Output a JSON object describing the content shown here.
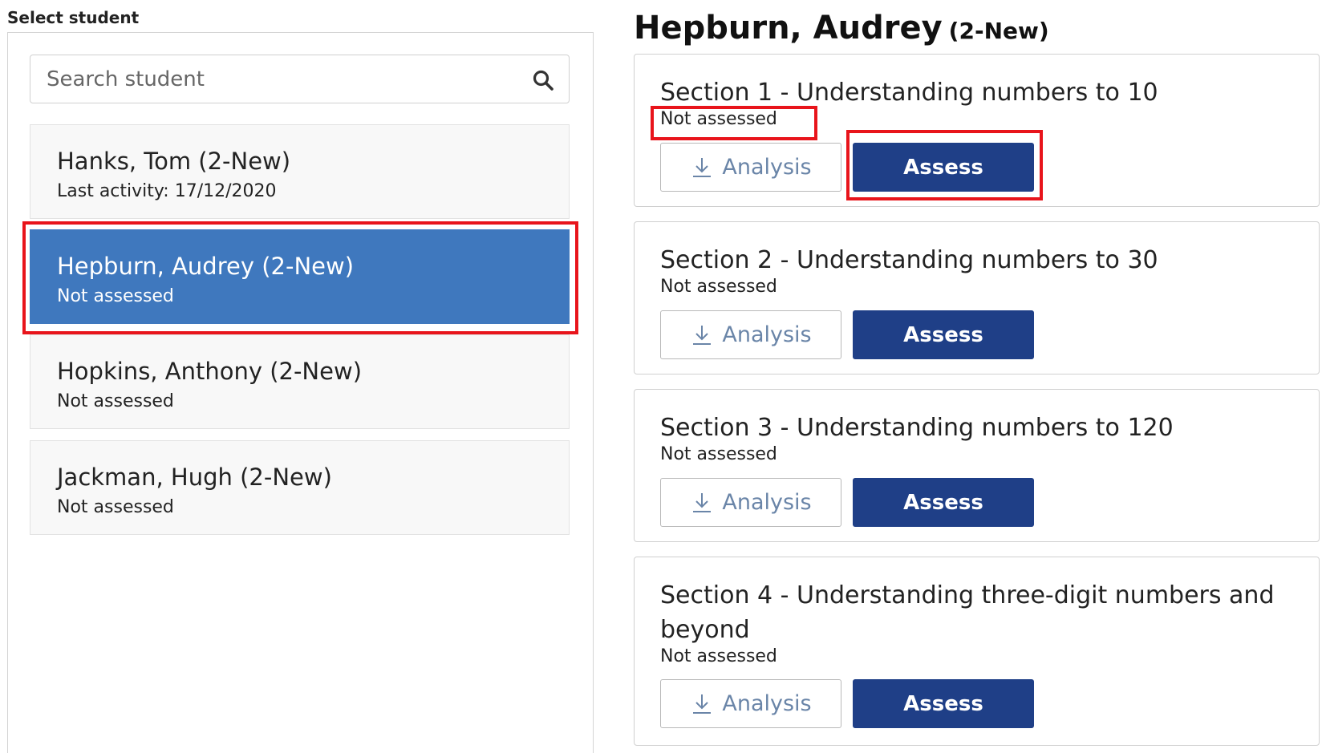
{
  "sidebar": {
    "label": "Select student",
    "search": {
      "placeholder": "Search student",
      "icon": "search-icon"
    },
    "students": [
      {
        "name": "Hanks, Tom (2-New)",
        "sub": "Last activity: 17/12/2020",
        "selected": false
      },
      {
        "name": "Hepburn, Audrey (2-New)",
        "sub": "Not assessed",
        "selected": true
      },
      {
        "name": "Hopkins, Anthony (2-New)",
        "sub": "Not assessed",
        "selected": false
      },
      {
        "name": "Jackman, Hugh (2-New)",
        "sub": "Not assessed",
        "selected": false
      }
    ]
  },
  "main": {
    "student_name": "Hepburn, Audrey",
    "student_group": "(2-New)",
    "sections": [
      {
        "title": "Section 1 - Understanding numbers to 10",
        "status": "Not assessed",
        "analysis_label": "Analysis",
        "assess_label": "Assess"
      },
      {
        "title": "Section 2 - Understanding numbers to 30",
        "status": "Not assessed",
        "analysis_label": "Analysis",
        "assess_label": "Assess"
      },
      {
        "title": "Section 3 - Understanding numbers to 120",
        "status": "Not assessed",
        "analysis_label": "Analysis",
        "assess_label": "Assess"
      },
      {
        "title": "Section 4 - Understanding three-digit numbers and beyond",
        "status": "Not assessed",
        "analysis_label": "Analysis",
        "assess_label": "Assess"
      }
    ]
  },
  "colors": {
    "selected_bg": "#3f78be",
    "assess_bg": "#1f3f87",
    "highlight": "#e8141b"
  }
}
